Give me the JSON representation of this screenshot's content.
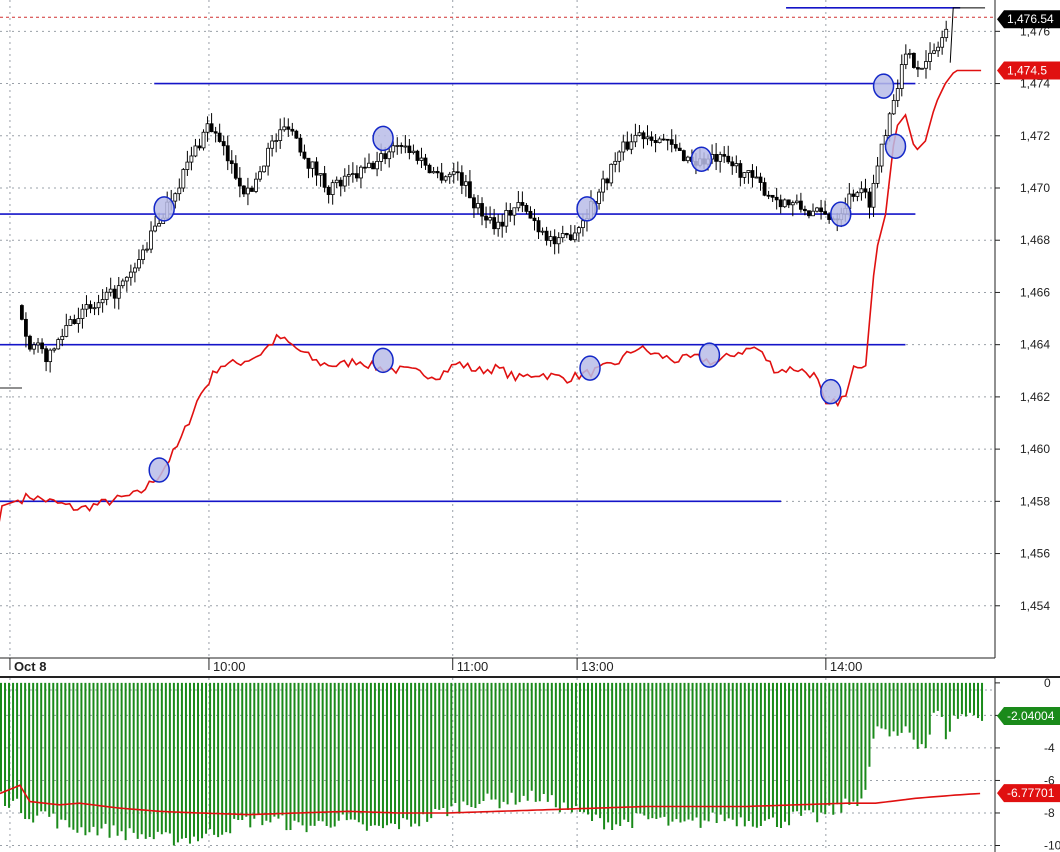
{
  "colors": {
    "background": "#ffffff",
    "grid": "#9aa0a8",
    "level_line": "#1414c8",
    "marker_fill": "#b8bce8",
    "marker_stroke": "#1428c8",
    "red_line": "#e01010",
    "hist_green": "#1a8a1a",
    "axis": "#222222",
    "current_price_dash": "#d03030"
  },
  "chart_data": [
    {
      "type": "candlestick",
      "time_labels": [
        "Oct 8",
        "10:00",
        "11:00",
        "13:00",
        "14:00"
      ],
      "y_ticks": [
        "1,454",
        "1,456",
        "1,458",
        "1,460",
        "1,462",
        "1,464",
        "1,466",
        "1,468",
        "1,470",
        "1,472",
        "1,474",
        "1,476"
      ],
      "ylim": [
        1452.0,
        1477.2
      ],
      "price_tag": "1,476.54",
      "red_tag": "1,474.5",
      "horizontal_levels": [
        {
          "y": 1476.9,
          "from": 0.79,
          "to": 0.965
        },
        {
          "y": 1474.0,
          "from": 0.155,
          "to": 0.92
        },
        {
          "y": 1469.0,
          "from": 0.0,
          "to": 0.92
        },
        {
          "y": 1464.0,
          "from": 0.0,
          "to": 0.91
        },
        {
          "y": 1458.0,
          "from": 0.0,
          "to": 0.785
        }
      ],
      "price_anchors": [
        [
          0.0,
          1467.5
        ],
        [
          0.02,
          1465.5
        ],
        [
          0.03,
          1464.0
        ],
        [
          0.05,
          1463.5
        ],
        [
          0.07,
          1465.0
        ],
        [
          0.1,
          1465.5
        ],
        [
          0.13,
          1466.5
        ],
        [
          0.15,
          1468.0
        ],
        [
          0.17,
          1469.5
        ],
        [
          0.19,
          1471.0
        ],
        [
          0.21,
          1472.5
        ],
        [
          0.23,
          1471.0
        ],
        [
          0.25,
          1469.7
        ],
        [
          0.27,
          1471.5
        ],
        [
          0.29,
          1472.5
        ],
        [
          0.31,
          1471.0
        ],
        [
          0.33,
          1470.0
        ],
        [
          0.35,
          1470.3
        ],
        [
          0.38,
          1471.0
        ],
        [
          0.4,
          1471.8
        ],
        [
          0.42,
          1471.2
        ],
        [
          0.44,
          1470.5
        ],
        [
          0.46,
          1470.6
        ],
        [
          0.48,
          1469.2
        ],
        [
          0.5,
          1468.6
        ],
        [
          0.52,
          1469.4
        ],
        [
          0.54,
          1468.6
        ],
        [
          0.56,
          1467.8
        ],
        [
          0.58,
          1468.5
        ],
        [
          0.6,
          1469.7
        ],
        [
          0.62,
          1471.2
        ],
        [
          0.64,
          1472.1
        ],
        [
          0.66,
          1472.0
        ],
        [
          0.68,
          1471.4
        ],
        [
          0.7,
          1471.0
        ],
        [
          0.72,
          1471.1
        ],
        [
          0.74,
          1470.8
        ],
        [
          0.76,
          1470.2
        ],
        [
          0.78,
          1469.6
        ],
        [
          0.8,
          1469.3
        ],
        [
          0.82,
          1469.0
        ],
        [
          0.84,
          1468.9
        ],
        [
          0.86,
          1470.0
        ],
        [
          0.875,
          1469.5
        ],
        [
          0.885,
          1471.5
        ],
        [
          0.9,
          1473.8
        ],
        [
          0.91,
          1475.0
        ],
        [
          0.93,
          1474.7
        ],
        [
          0.945,
          1475.6
        ],
        [
          0.955,
          1476.4
        ]
      ],
      "red_anchors": [
        [
          -0.01,
          1453.5
        ],
        [
          0.0,
          1457.8
        ],
        [
          0.03,
          1458.2
        ],
        [
          0.05,
          1458.0
        ],
        [
          0.08,
          1457.7
        ],
        [
          0.11,
          1458.0
        ],
        [
          0.14,
          1458.3
        ],
        [
          0.16,
          1459.0
        ],
        [
          0.18,
          1460.2
        ],
        [
          0.2,
          1462.0
        ],
        [
          0.22,
          1463.2
        ],
        [
          0.24,
          1463.3
        ],
        [
          0.26,
          1463.6
        ],
        [
          0.28,
          1464.3
        ],
        [
          0.3,
          1463.8
        ],
        [
          0.32,
          1463.3
        ],
        [
          0.34,
          1463.2
        ],
        [
          0.36,
          1463.4
        ],
        [
          0.38,
          1463.1
        ],
        [
          0.41,
          1463.0
        ],
        [
          0.44,
          1462.8
        ],
        [
          0.46,
          1463.3
        ],
        [
          0.48,
          1463.0
        ],
        [
          0.5,
          1463.1
        ],
        [
          0.52,
          1462.7
        ],
        [
          0.54,
          1462.9
        ],
        [
          0.57,
          1462.7
        ],
        [
          0.6,
          1463.0
        ],
        [
          0.62,
          1463.3
        ],
        [
          0.64,
          1463.9
        ],
        [
          0.66,
          1463.6
        ],
        [
          0.68,
          1463.4
        ],
        [
          0.7,
          1463.5
        ],
        [
          0.72,
          1463.3
        ],
        [
          0.74,
          1463.7
        ],
        [
          0.76,
          1463.9
        ],
        [
          0.78,
          1463.0
        ],
        [
          0.8,
          1463.1
        ],
        [
          0.82,
          1462.8
        ],
        [
          0.83,
          1461.6
        ],
        [
          0.85,
          1462.0
        ],
        [
          0.86,
          1463.3
        ],
        [
          0.87,
          1463.2
        ],
        [
          0.88,
          1467.5
        ],
        [
          0.89,
          1469.0
        ],
        [
          0.9,
          1472.3
        ],
        [
          0.91,
          1472.8
        ],
        [
          0.92,
          1471.4
        ],
        [
          0.93,
          1471.8
        ],
        [
          0.94,
          1473.2
        ],
        [
          0.95,
          1474.0
        ],
        [
          0.96,
          1474.5
        ],
        [
          0.99,
          1474.5
        ]
      ],
      "markers": [
        {
          "x": 0.165,
          "y": 1469.2
        },
        {
          "x": 0.385,
          "y": 1471.9
        },
        {
          "x": 0.59,
          "y": 1469.2
        },
        {
          "x": 0.705,
          "y": 1471.1
        },
        {
          "x": 0.845,
          "y": 1469.0
        },
        {
          "x": 0.888,
          "y": 1473.9
        },
        {
          "x": 0.16,
          "y": 1459.2
        },
        {
          "x": 0.385,
          "y": 1463.4
        },
        {
          "x": 0.593,
          "y": 1463.1
        },
        {
          "x": 0.713,
          "y": 1463.6
        },
        {
          "x": 0.835,
          "y": 1462.2
        },
        {
          "x": 0.9,
          "y": 1471.6
        }
      ]
    },
    {
      "type": "bar",
      "y_ticks": [
        "0",
        "-2",
        "-4",
        "-6",
        "-8",
        "-10"
      ],
      "ylim": [
        -10.4,
        0.3
      ],
      "green_tag": "-2.04004",
      "red_tag": "-6.77701",
      "bar_anchors": [
        [
          0.0,
          -7.0
        ],
        [
          0.015,
          -7.5
        ],
        [
          0.03,
          -8.2
        ],
        [
          0.045,
          -8.0
        ],
        [
          0.06,
          -8.7
        ],
        [
          0.08,
          -9.0
        ],
        [
          0.1,
          -9.0
        ],
        [
          0.12,
          -9.2
        ],
        [
          0.14,
          -9.4
        ],
        [
          0.16,
          -9.6
        ],
        [
          0.18,
          -9.6
        ],
        [
          0.2,
          -9.5
        ],
        [
          0.22,
          -9.1
        ],
        [
          0.24,
          -8.6
        ],
        [
          0.26,
          -8.4
        ],
        [
          0.28,
          -8.5
        ],
        [
          0.3,
          -8.9
        ],
        [
          0.32,
          -8.7
        ],
        [
          0.34,
          -8.4
        ],
        [
          0.36,
          -8.9
        ],
        [
          0.38,
          -9.0
        ],
        [
          0.4,
          -8.7
        ],
        [
          0.42,
          -8.5
        ],
        [
          0.44,
          -8.0
        ],
        [
          0.46,
          -7.6
        ],
        [
          0.48,
          -7.2
        ],
        [
          0.5,
          -7.3
        ],
        [
          0.52,
          -7.1
        ],
        [
          0.54,
          -7.0
        ],
        [
          0.56,
          -7.5
        ],
        [
          0.58,
          -8.0
        ],
        [
          0.6,
          -8.5
        ],
        [
          0.62,
          -8.7
        ],
        [
          0.64,
          -8.4
        ],
        [
          0.66,
          -8.4
        ],
        [
          0.68,
          -8.8
        ],
        [
          0.7,
          -8.6
        ],
        [
          0.72,
          -8.3
        ],
        [
          0.74,
          -8.4
        ],
        [
          0.76,
          -8.5
        ],
        [
          0.78,
          -8.6
        ],
        [
          0.8,
          -8.2
        ],
        [
          0.82,
          -8.3
        ],
        [
          0.84,
          -7.8
        ],
        [
          0.86,
          -7.2
        ],
        [
          0.87,
          -6.5
        ],
        [
          0.88,
          -2.5
        ],
        [
          0.89,
          -3.2
        ],
        [
          0.9,
          -3.5
        ],
        [
          0.91,
          -2.6
        ],
        [
          0.92,
          -3.6
        ],
        [
          0.93,
          -3.9
        ],
        [
          0.94,
          -1.5
        ],
        [
          0.95,
          -3.2
        ],
        [
          0.96,
          -2.0
        ],
        [
          0.99,
          -2.0
        ]
      ],
      "red_anchors": [
        [
          0.0,
          -6.8
        ],
        [
          0.02,
          -6.3
        ],
        [
          0.03,
          -7.3
        ],
        [
          0.06,
          -7.5
        ],
        [
          0.08,
          -7.4
        ],
        [
          0.12,
          -7.7
        ],
        [
          0.16,
          -7.9
        ],
        [
          0.2,
          -8.0
        ],
        [
          0.25,
          -8.1
        ],
        [
          0.3,
          -8.0
        ],
        [
          0.35,
          -7.9
        ],
        [
          0.4,
          -8.0
        ],
        [
          0.45,
          -8.0
        ],
        [
          0.5,
          -7.9
        ],
        [
          0.55,
          -7.8
        ],
        [
          0.6,
          -7.7
        ],
        [
          0.65,
          -7.6
        ],
        [
          0.7,
          -7.6
        ],
        [
          0.75,
          -7.6
        ],
        [
          0.8,
          -7.5
        ],
        [
          0.85,
          -7.4
        ],
        [
          0.88,
          -7.4
        ],
        [
          0.92,
          -7.1
        ],
        [
          0.96,
          -6.9
        ],
        [
          0.99,
          -6.78
        ]
      ]
    }
  ]
}
